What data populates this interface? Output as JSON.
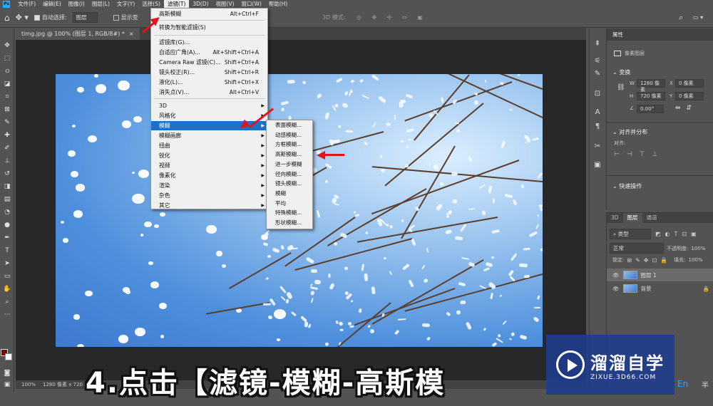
{
  "menubar": {
    "items": [
      "文件(F)",
      "编辑(E)",
      "图像(I)",
      "图层(L)",
      "文字(Y)",
      "选择(S)",
      "滤镜(T)",
      "3D(D)",
      "视图(V)",
      "窗口(W)",
      "帮助(H)"
    ],
    "active_index": 6
  },
  "options_bar": {
    "auto_select_label": "自动选择:",
    "auto_select_value": "图层",
    "show_transform_label": "显示变",
    "mode_3d_label": "3D 模式:"
  },
  "document": {
    "tab_title": "timg.jpg @ 100% (图层 1, RGB/8#) *",
    "close_glyph": "×"
  },
  "statusbar": {
    "zoom": "100%",
    "size": "1280 像素 x 720 像素"
  },
  "filter_menu": {
    "items": [
      {
        "label": "高斯模糊",
        "shortcut": "Alt+Ctrl+F"
      },
      {
        "label": "转换为智能滤镜(S)",
        "shortcut": ""
      },
      {
        "label": "滤镜库(G)...",
        "shortcut": ""
      },
      {
        "label": "自适应广角(A)...",
        "shortcut": "Alt+Shift+Ctrl+A"
      },
      {
        "label": "Camera Raw 滤镜(C)...",
        "shortcut": "Shift+Ctrl+A"
      },
      {
        "label": "镜头校正(R)...",
        "shortcut": "Shift+Ctrl+R"
      },
      {
        "label": "液化(L)...",
        "shortcut": "Shift+Ctrl+X"
      },
      {
        "label": "消失点(V)...",
        "shortcut": "Alt+Ctrl+V"
      },
      {
        "label": "3D",
        "shortcut": ""
      },
      {
        "label": "风格化",
        "shortcut": ""
      },
      {
        "label": "模糊",
        "shortcut": ""
      },
      {
        "label": "模糊画廊",
        "shortcut": ""
      },
      {
        "label": "扭曲",
        "shortcut": ""
      },
      {
        "label": "锐化",
        "shortcut": ""
      },
      {
        "label": "视频",
        "shortcut": ""
      },
      {
        "label": "像素化",
        "shortcut": ""
      },
      {
        "label": "渲染",
        "shortcut": ""
      },
      {
        "label": "杂色",
        "shortcut": ""
      },
      {
        "label": "其它",
        "shortcut": ""
      }
    ],
    "highlighted": "模糊",
    "submenu_arrow": "▶"
  },
  "blur_submenu": {
    "items": [
      "表面模糊...",
      "动感模糊...",
      "方框模糊...",
      "高斯模糊...",
      "进一步模糊",
      "径向模糊...",
      "镜头模糊...",
      "模糊",
      "平均",
      "特殊模糊...",
      "形状模糊..."
    ]
  },
  "properties_panel": {
    "tab": "属性",
    "layer_type": "像素图层",
    "transform_title": "变换",
    "w_label": "W",
    "w_value": "1280 像素",
    "x_label": "X",
    "x_value": "0 像素",
    "h_label": "H",
    "h_value": "720 像素",
    "y_label": "Y",
    "y_value": "0 像素",
    "angle_value": "0.00°",
    "align_title": "对齐并分布",
    "align_label": "对齐:",
    "quick_actions": "快速操作"
  },
  "layers_panel": {
    "tabs": [
      "3D",
      "图层",
      "通道"
    ],
    "active_tab": "图层",
    "kind_label": "类型",
    "blend_mode": "正常",
    "opacity_label": "不透明度:",
    "opacity_value": "100%",
    "lock_label": "锁定:",
    "fill_label": "填充:",
    "fill_value": "100%",
    "layers": [
      {
        "name": "图层 1",
        "selected": true
      },
      {
        "name": "背景",
        "selected": false
      }
    ]
  },
  "subtitle": "4.点击【滤镜-模糊-高斯模",
  "watermark": {
    "title": "溜溜自学",
    "url": "ZIXUE.3D66.COM"
  },
  "misc": {
    "en_indicator": "En",
    "half_label": "半"
  },
  "colors": {
    "foreground": "#7a0b0b",
    "background": "#ffffff",
    "menu_highlight": "#1e6fc8",
    "annotation_red": "#e0141a"
  }
}
